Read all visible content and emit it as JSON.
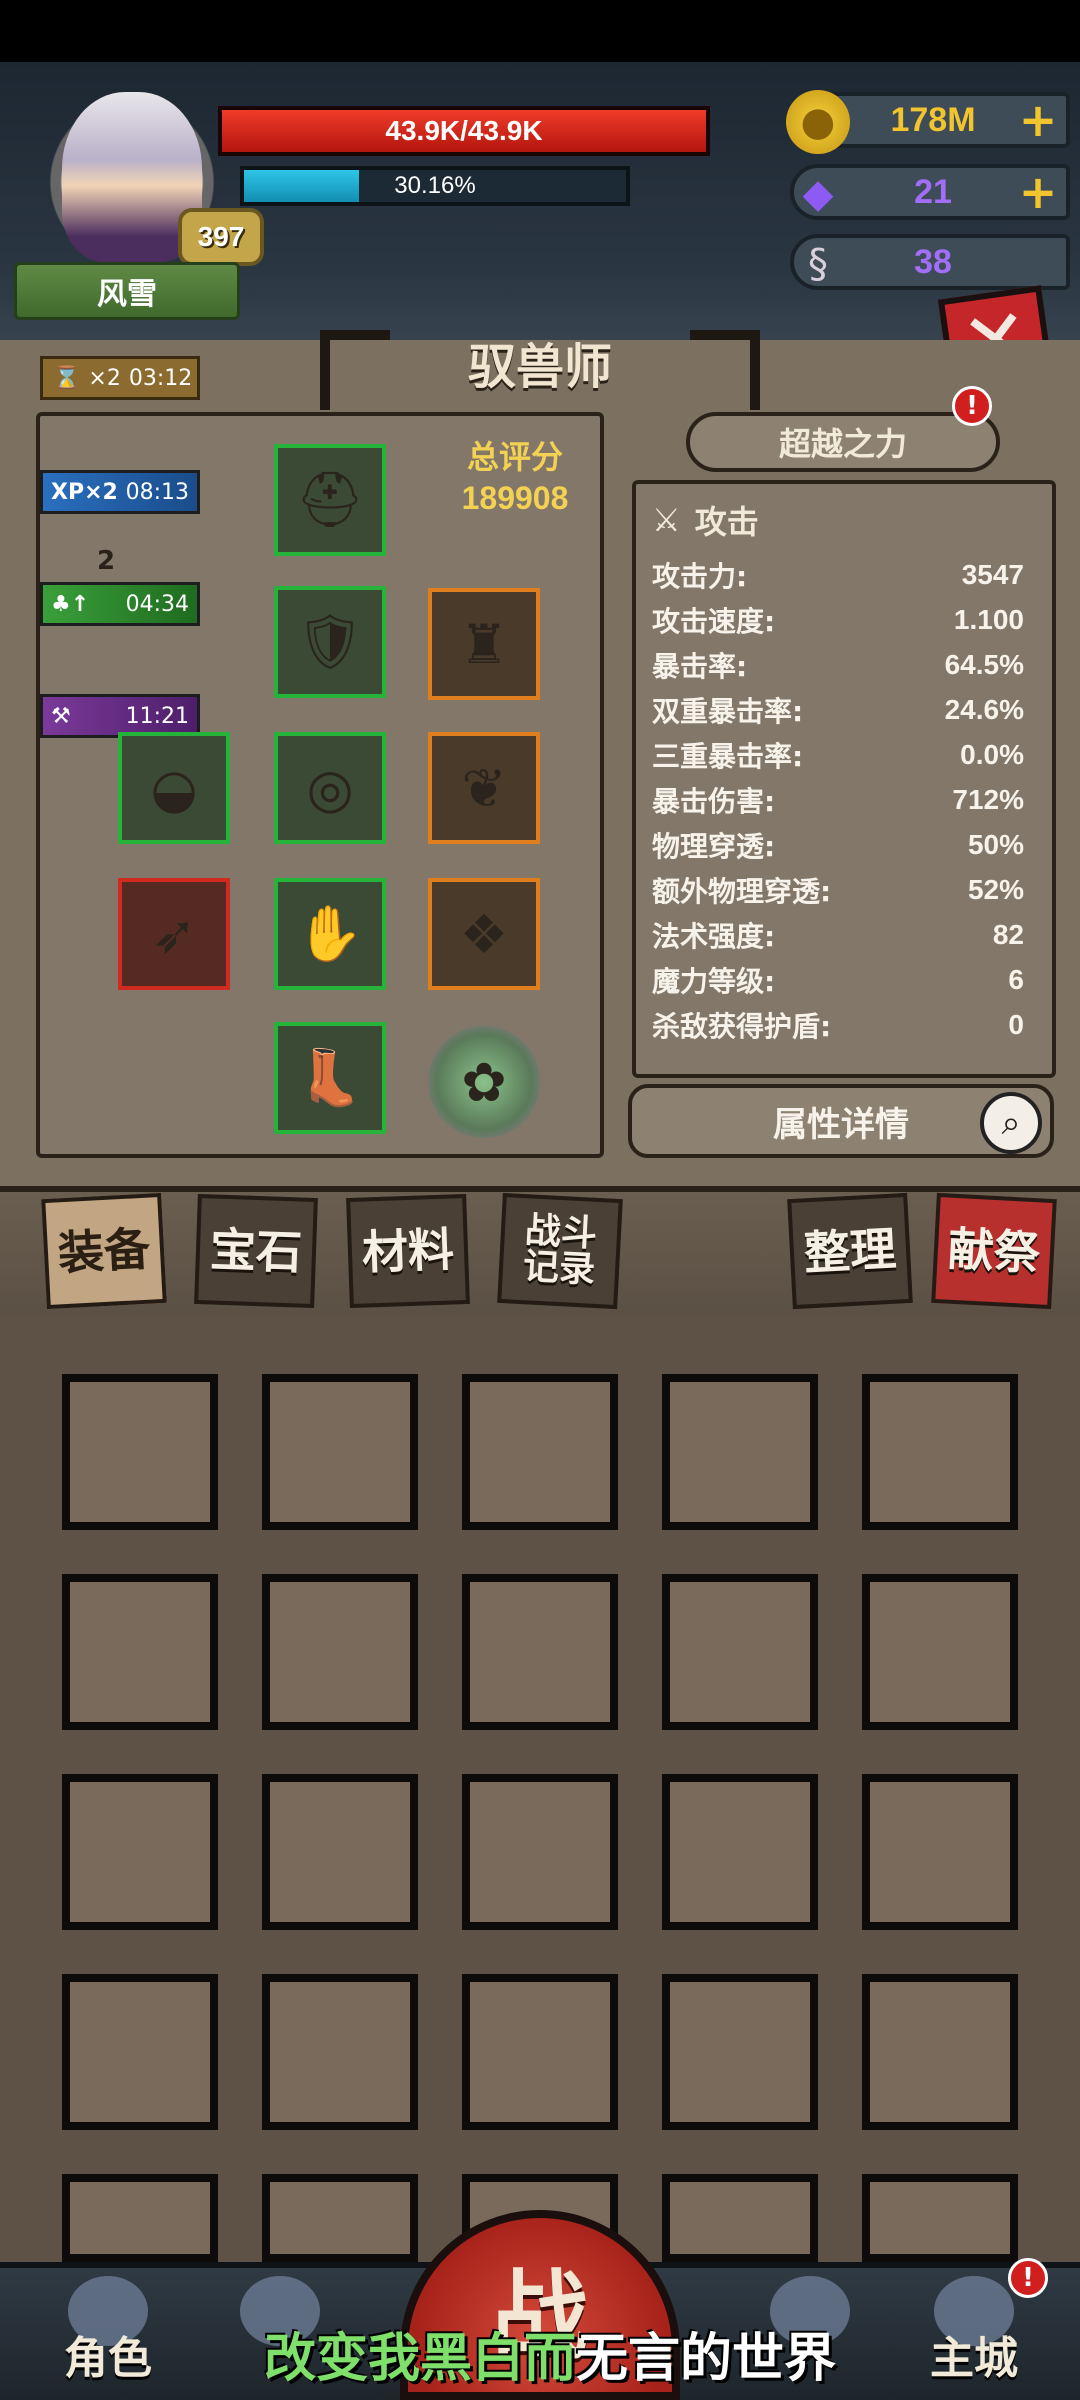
{
  "player": {
    "name": "风雪",
    "level": "397",
    "hp_text": "43.9K/43.9K",
    "hp_ratio": 1.0,
    "xp_text": "30.16%",
    "xp_ratio": 0.3016
  },
  "currencies": {
    "gold": "178M",
    "gem": "21",
    "horn": "38"
  },
  "page_title": "驭兽师",
  "buffs": {
    "top_timer": {
      "mult": "×2",
      "time": "03:12"
    },
    "xp": {
      "label": "XP×2",
      "time": "08:13"
    },
    "luck": {
      "level": "2",
      "time": "04:34"
    },
    "hammer": {
      "time": "11:21"
    }
  },
  "score": {
    "label": "总评分",
    "value": "189908"
  },
  "transcend_label": "超越之力",
  "stats": {
    "header": "攻击",
    "rows": [
      {
        "k": "攻击力:",
        "v": "3547"
      },
      {
        "k": "攻击速度:",
        "v": "1.100"
      },
      {
        "k": "暴击率:",
        "v": "64.5%"
      },
      {
        "k": "双重暴击率:",
        "v": "24.6%"
      },
      {
        "k": "三重暴击率:",
        "v": "0.0%"
      },
      {
        "k": "暴击伤害:",
        "v": "712%"
      },
      {
        "k": "物理穿透:",
        "v": "50%"
      },
      {
        "k": "额外物理穿透:",
        "v": "52%"
      },
      {
        "k": "法术强度:",
        "v": "82"
      },
      {
        "k": "魔力等级:",
        "v": "6"
      },
      {
        "k": "杀敌获得护盾:",
        "v": "0"
      }
    ]
  },
  "detail_label": "属性详情",
  "tabs": {
    "equipment": "装备",
    "gems": "宝石",
    "materials": "材料",
    "battle_log_1": "战斗",
    "battle_log_2": "记录",
    "arrange": "整理",
    "sacrifice": "献祭"
  },
  "nav": {
    "character": "角色",
    "battle": "战",
    "city": "主城"
  },
  "subtitle": {
    "part1": "改变我黑白而",
    "part2": "无言的世界"
  },
  "colors": {
    "hp": "#e02a1c",
    "xp": "#1fa9d0",
    "gold": "#f2c42d",
    "gem": "#a36ef7"
  }
}
